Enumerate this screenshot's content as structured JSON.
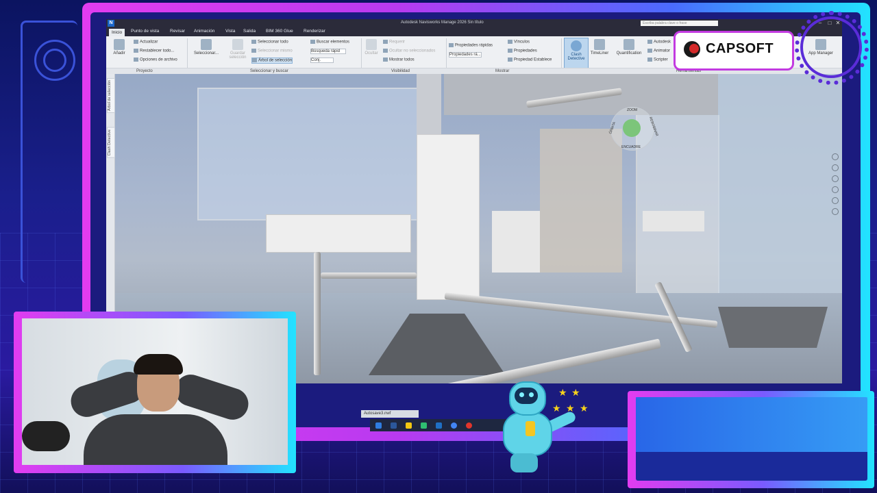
{
  "app": {
    "logo_letter": "N",
    "window_title": "Autodesk Navisworks Manage 2026   Sin título",
    "search_placeholder": "Escriba palabra clave o frase",
    "tabs": [
      "Inicio",
      "Punto de vista",
      "Revisar",
      "Animación",
      "Vista",
      "Salida",
      "BIM 360 Glue",
      "Renderizar"
    ],
    "ribbon": {
      "proyecto": {
        "add_label": "Añadir",
        "items": [
          "Actualizar",
          "Restablecer todo...",
          "Opciones de archivo"
        ],
        "group_label": "Proyecto"
      },
      "seleccionar": {
        "select_label": "Seleccionar...",
        "save_label": "Guardar selección",
        "items": [
          "Seleccionar todo",
          "Seleccionar mismo",
          "Árbol de selección"
        ],
        "buscar": "Buscar elementos",
        "busqueda_rapida": "Búsqueda rápid",
        "conjuntos": "Conj.",
        "group_label": "Seleccionar y buscar"
      },
      "visibilidad": {
        "ocultar": "Ocultar",
        "items": [
          "Requerir",
          "Ocultar no seleccionados",
          "Mostrar todos"
        ],
        "group_label": "Visibilidad"
      },
      "mostrar": {
        "items": [
          "Propiedades rápidas",
          "Propiedades rá...",
          "Vínculos",
          "Propiedades",
          "Propiedad Establece"
        ],
        "group_label": "Mostrar"
      },
      "herramientas": {
        "clash": "Clash Detective",
        "timeliner": "TimeLiner",
        "quantification": "Quantification",
        "items": [
          "Autodesk",
          "Animator",
          "Scripter"
        ],
        "app_manager": "App Manager",
        "group_label": "Herramientas"
      }
    },
    "side_tabs": [
      "Árbol de selección",
      "Clash Detective"
    ],
    "viewcube": {
      "top": "ZOOM",
      "bottom": "ENCUADRE",
      "left": "ÓRBITA",
      "right": "REBOBINAR"
    },
    "filename": "Autosave3.nwf"
  },
  "overlay": {
    "brand_name": "CAPSOFT",
    "brand_color": "#d42a2a",
    "frame_gradient": [
      "#e23cf0",
      "#22e3ff"
    ]
  }
}
